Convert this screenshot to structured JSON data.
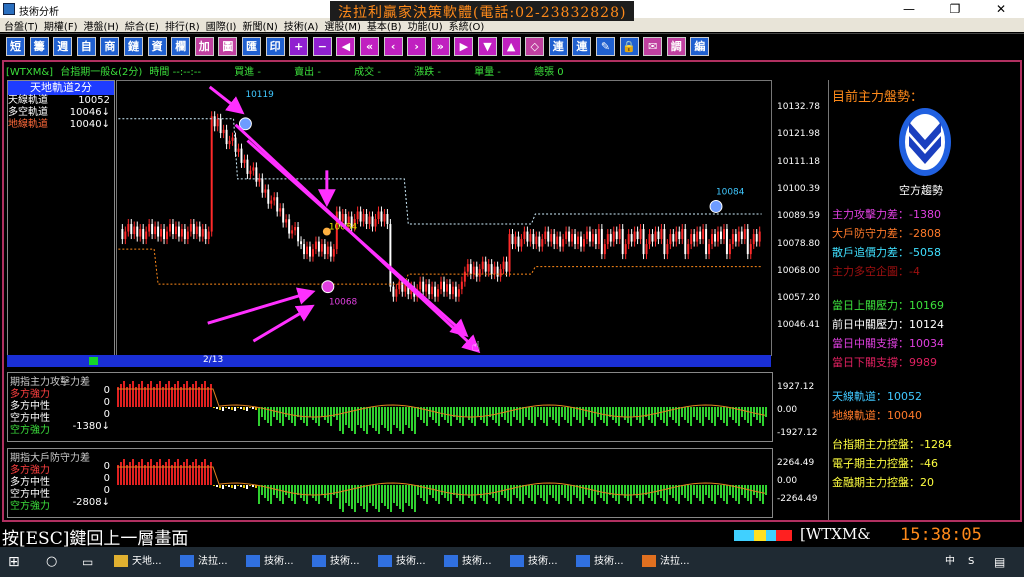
{
  "window": {
    "title": "技術分析",
    "min": "—",
    "restore": "❐",
    "close": "✕"
  },
  "menu": [
    "台盤(T)",
    "期權(F)",
    "港盤(H)",
    "綜合(E)",
    "排行(R)",
    "國際(I)",
    "新聞(N)",
    "技術(A)",
    "選股(M)",
    "基本(B)",
    "功能(U)",
    "系統(O)"
  ],
  "promo": "法拉利贏家決策軟體(電話:02-23832828)",
  "toolbar": [
    "短",
    "籌",
    "週",
    "自",
    "商",
    "鏈",
    "資",
    "欄",
    "加",
    "圖",
    "匯",
    "印",
    "+",
    "−",
    "◀",
    "«",
    "‹",
    "›",
    "»",
    "▶",
    "▼",
    "▲",
    "◇",
    "連",
    "連",
    "✎",
    "🔒",
    "✉",
    "調",
    "編"
  ],
  "info": {
    "symbol": "[WTXM&]",
    "name": "台指期一般&(2分)",
    "time": "時間 --:--:--",
    "buy": "買進 -",
    "sell": "賣出 -",
    "deal": "成交 -",
    "change": "漲跌 -",
    "vol": "單量 -",
    "total": "總張 0"
  },
  "left": {
    "title": "天地軌道2分",
    "rows": [
      {
        "label": "天線軌道",
        "value": "10052",
        "color": "#ffffff"
      },
      {
        "label": "多空軌道",
        "value": "10046↓",
        "color": "#ffffff"
      },
      {
        "label": "地線軌道",
        "value": "10040↓",
        "color": "#ff6a3a"
      }
    ],
    "page": "2/13"
  },
  "price_axis": [
    "10132.78",
    "10121.98",
    "10111.18",
    "10100.39",
    "10089.59",
    "10078.80",
    "10068.00",
    "10057.20",
    "10046.41"
  ],
  "annotations": {
    "hi": "10119",
    "mid": "10084",
    "low": "10068",
    "right": "10084"
  },
  "right": {
    "heading": "目前主力盤勢：",
    "trend": "空方趨勢",
    "items": [
      {
        "label": "主力攻擊力差：-1380",
        "color": "#e040e0"
      },
      {
        "label": "大戶防守力差：-2808",
        "color": "#ff7a2a"
      },
      {
        "label": "散戶追價力差：-5058",
        "color": "#40e0ff"
      },
      {
        "label": "主力多空企圖：-4",
        "color": "#a01010"
      },
      {
        "label": "當日上關壓力：10169",
        "color": "#3ce03c"
      },
      {
        "label": "前日中關壓力：10124",
        "color": "#ffffff"
      },
      {
        "label": "當日中關支撐：10034",
        "color": "#e040e0"
      },
      {
        "label": "當日下關支撐：9989",
        "color": "#e02060"
      },
      {
        "label": "天線軌道：10052",
        "color": "#40c8ff"
      },
      {
        "label": "地線軌道：10040",
        "color": "#ff7a2a"
      },
      {
        "label": "台指期主力控盤：-1284",
        "color": "#ffff40"
      },
      {
        "label": "電子期主力控盤：-46",
        "color": "#ffff40"
      },
      {
        "label": "金融期主力控盤：20",
        "color": "#ffff40"
      }
    ]
  },
  "ind1": {
    "title": "期指主力攻擊力差",
    "rows": [
      {
        "label": "多方強力",
        "value": "0",
        "color": "#ff4040"
      },
      {
        "label": "多方中性",
        "value": "0",
        "color": "#ffffff"
      },
      {
        "label": "空方中性",
        "value": "0",
        "color": "#ffffff"
      },
      {
        "label": "空方強力",
        "value": "-1380↓",
        "color": "#3ce03c"
      }
    ],
    "ticks": [
      "1927.12",
      "0.00",
      "-1927.12"
    ]
  },
  "ind2": {
    "title": "期指大戶防守力差",
    "rows": [
      {
        "label": "多方強力",
        "value": "0",
        "color": "#ff4040"
      },
      {
        "label": "多方中性",
        "value": "0",
        "color": "#ffffff"
      },
      {
        "label": "空方中性",
        "value": "0",
        "color": "#ffffff"
      },
      {
        "label": "空方強力",
        "value": "-2808↓",
        "color": "#3ce03c"
      }
    ],
    "ticks": [
      "2264.49",
      "0.00",
      "-2264.49"
    ]
  },
  "status": {
    "esc": "按[ESC]鍵回上一層畫面",
    "code": "[WTXM&",
    "clock": "15:38:05"
  },
  "taskbar": [
    "天地...",
    "法拉...",
    "技術...",
    "技術...",
    "技術...",
    "技術...",
    "技術...",
    "技術...",
    "法拉..."
  ],
  "tray": {
    "ime": "中",
    "lang": "S"
  }
}
